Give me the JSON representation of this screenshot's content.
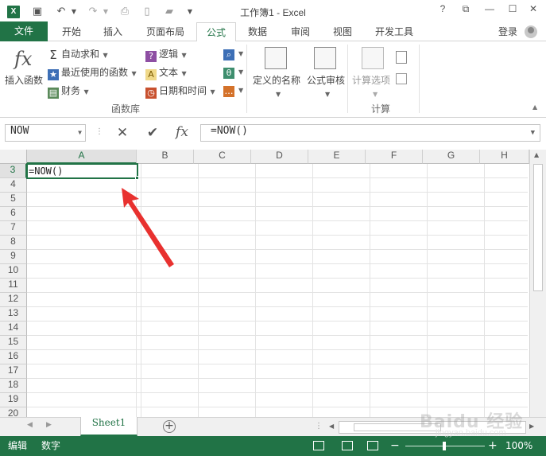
{
  "window": {
    "title": "工作簿1 - Excel",
    "help": "?",
    "minimize": "—",
    "close": "✕"
  },
  "quick_access": {
    "save_icon": "save-icon",
    "undo_icon": "undo-icon",
    "redo_icon": "redo-icon"
  },
  "tabs": {
    "file": "文件",
    "items": [
      "开始",
      "插入",
      "页面布局",
      "公式",
      "数据",
      "审阅",
      "视图",
      "开发工具"
    ],
    "active": "公式",
    "login": "登录"
  },
  "ribbon": {
    "insert_function": "插入函数",
    "autosum": "自动求和",
    "recent": "最近使用的函数",
    "financial": "财务",
    "logical": "逻辑",
    "text": "文本",
    "datetime": "日期和时间",
    "group_function_library": "函数库",
    "defined_names": "定义的名称",
    "formula_auditing": "公式审核",
    "calc_options": "计算选项",
    "group_calculation": "计算"
  },
  "formula_bar": {
    "name_box": "NOW",
    "cancel": "✕",
    "enter": "✔",
    "fx": "fx",
    "formula": "=NOW()"
  },
  "grid": {
    "columns": [
      "A",
      "B",
      "C",
      "D",
      "E",
      "F",
      "G",
      "H"
    ],
    "rows": [
      "3",
      "4",
      "5",
      "6",
      "7",
      "8",
      "9",
      "10",
      "11",
      "12",
      "13",
      "14",
      "15",
      "16",
      "17",
      "18",
      "19",
      "20"
    ],
    "active_cell_text": "=NOW()"
  },
  "sheets": {
    "tabs": [
      "Sheet1"
    ],
    "add_icon": "plus-icon"
  },
  "status": {
    "mode": "编辑",
    "numlock": "数字",
    "zoom": "100%"
  },
  "watermark": {
    "brand": "Baidu 经验",
    "site": "jingyan.baidu.com"
  },
  "colors": {
    "accent": "#217346",
    "arrow": "#e8312f"
  }
}
